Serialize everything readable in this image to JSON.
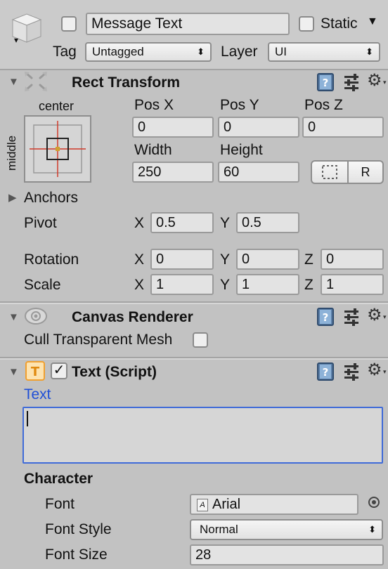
{
  "gameobject": {
    "name": "Message Text",
    "static_label": "Static",
    "tag_label": "Tag",
    "tag_value": "Untagged",
    "layer_label": "Layer",
    "layer_value": "UI"
  },
  "rect_transform": {
    "title": "Rect Transform",
    "anchor_h": "center",
    "anchor_v": "middle",
    "pos_x_label": "Pos X",
    "pos_y_label": "Pos Y",
    "pos_z_label": "Pos Z",
    "pos_x": "0",
    "pos_y": "0",
    "pos_z": "0",
    "width_label": "Width",
    "height_label": "Height",
    "width": "250",
    "height": "60",
    "raw_edit_label": "R",
    "anchors_label": "Anchors",
    "pivot_label": "Pivot",
    "pivot_x": "0.5",
    "pivot_y": "0.5",
    "rotation_label": "Rotation",
    "rotation_x": "0",
    "rotation_y": "0",
    "rotation_z": "0",
    "scale_label": "Scale",
    "scale_x": "1",
    "scale_y": "1",
    "scale_z": "1",
    "x": "X",
    "y": "Y",
    "z": "Z"
  },
  "canvas_renderer": {
    "title": "Canvas Renderer",
    "cull_label": "Cull Transparent Mesh"
  },
  "text_script": {
    "title": "Text (Script)",
    "text_label": "Text",
    "text_value": "",
    "character_label": "Character",
    "font_label": "Font",
    "font_value": "Arial",
    "font_style_label": "Font Style",
    "font_style_value": "Normal",
    "font_size_label": "Font Size",
    "font_size_value": "28"
  },
  "colors": {
    "panel_bg": "#c2c2c2",
    "accent_blue": "#1f4fd6",
    "text_icon_orange": "#f0a030",
    "anchor_red": "#d03a2a"
  }
}
